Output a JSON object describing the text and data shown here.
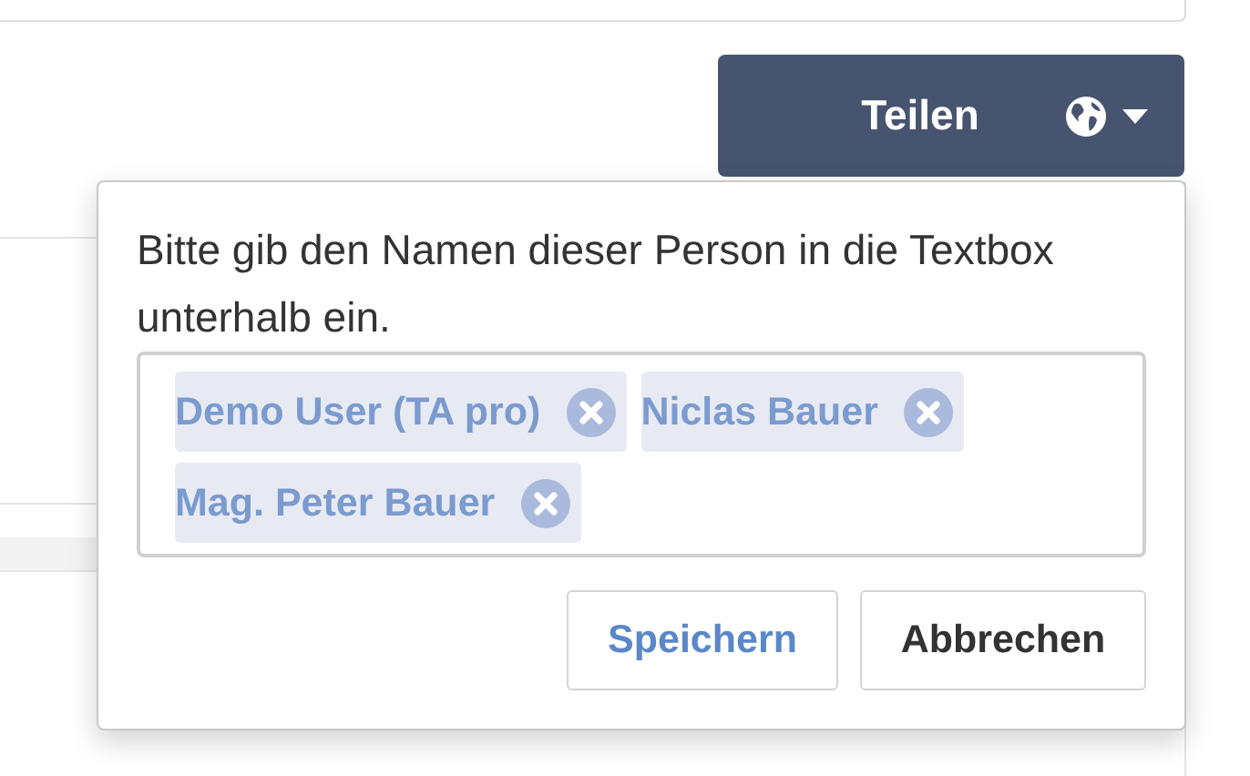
{
  "share_button": {
    "label": "Teilen"
  },
  "popover": {
    "message": "Bitte gib den Namen dieser Person in die Textbox unterhalb ein.",
    "tags": [
      {
        "label": "Demo User (TA pro)"
      },
      {
        "label": "Niclas Bauer"
      },
      {
        "label": "Mag. Peter Bauer"
      }
    ],
    "buttons": [
      {
        "label": "Speichern",
        "kind": "primary"
      },
      {
        "label": "Abbrechen",
        "kind": "default"
      }
    ]
  }
}
